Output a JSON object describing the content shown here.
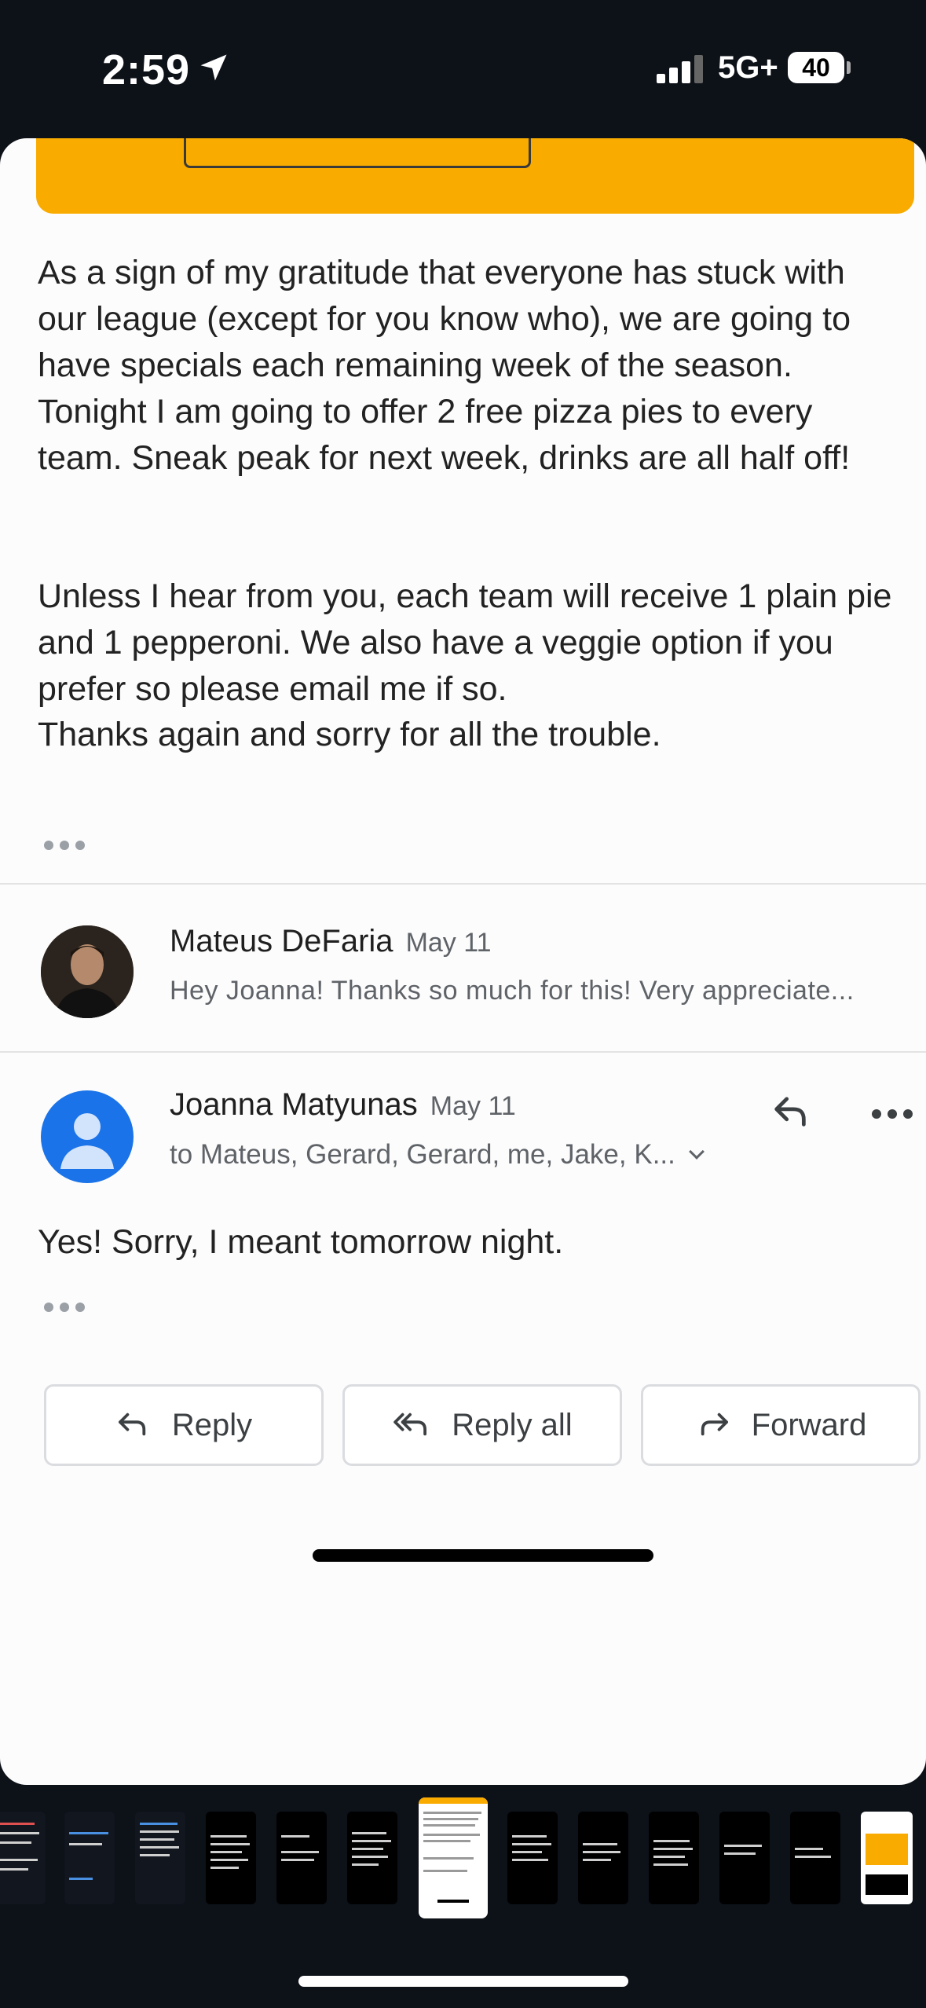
{
  "status_bar": {
    "time": "2:59",
    "network": "5G+",
    "battery": "40"
  },
  "email": {
    "body_paragraphs": [
      "As a sign of my gratitude that everyone has stuck with our league (except for you know who), we are going to have specials each remaining week of the season. Tonight I am going to offer 2 free pizza pies to every team. Sneak peak for next week, drinks are all half off!",
      "Unless I hear from you, each team will receive 1 plain pie and 1 pepperoni. We also have a veggie option if you prefer so please email me if so.",
      "Thanks again and sorry for all the trouble."
    ],
    "messages": [
      {
        "sender": "Mateus DeFaria",
        "date": "May 11",
        "snippet": "Hey Joanna! Thanks so much for this! Very appreciate..."
      },
      {
        "sender": "Joanna Matyunas",
        "date": "May 11",
        "recipients": "to Mateus, Gerard, Gerard, me, Jake, K...",
        "body": "Yes! Sorry, I meant tomorrow night."
      }
    ],
    "actions": {
      "reply": "Reply",
      "reply_all": "Reply all",
      "forward": "Forward"
    }
  },
  "colors": {
    "accent_yellow": "#f9ab00",
    "gmail_blue": "#1a73e8",
    "status_bg": "#0d1118"
  }
}
